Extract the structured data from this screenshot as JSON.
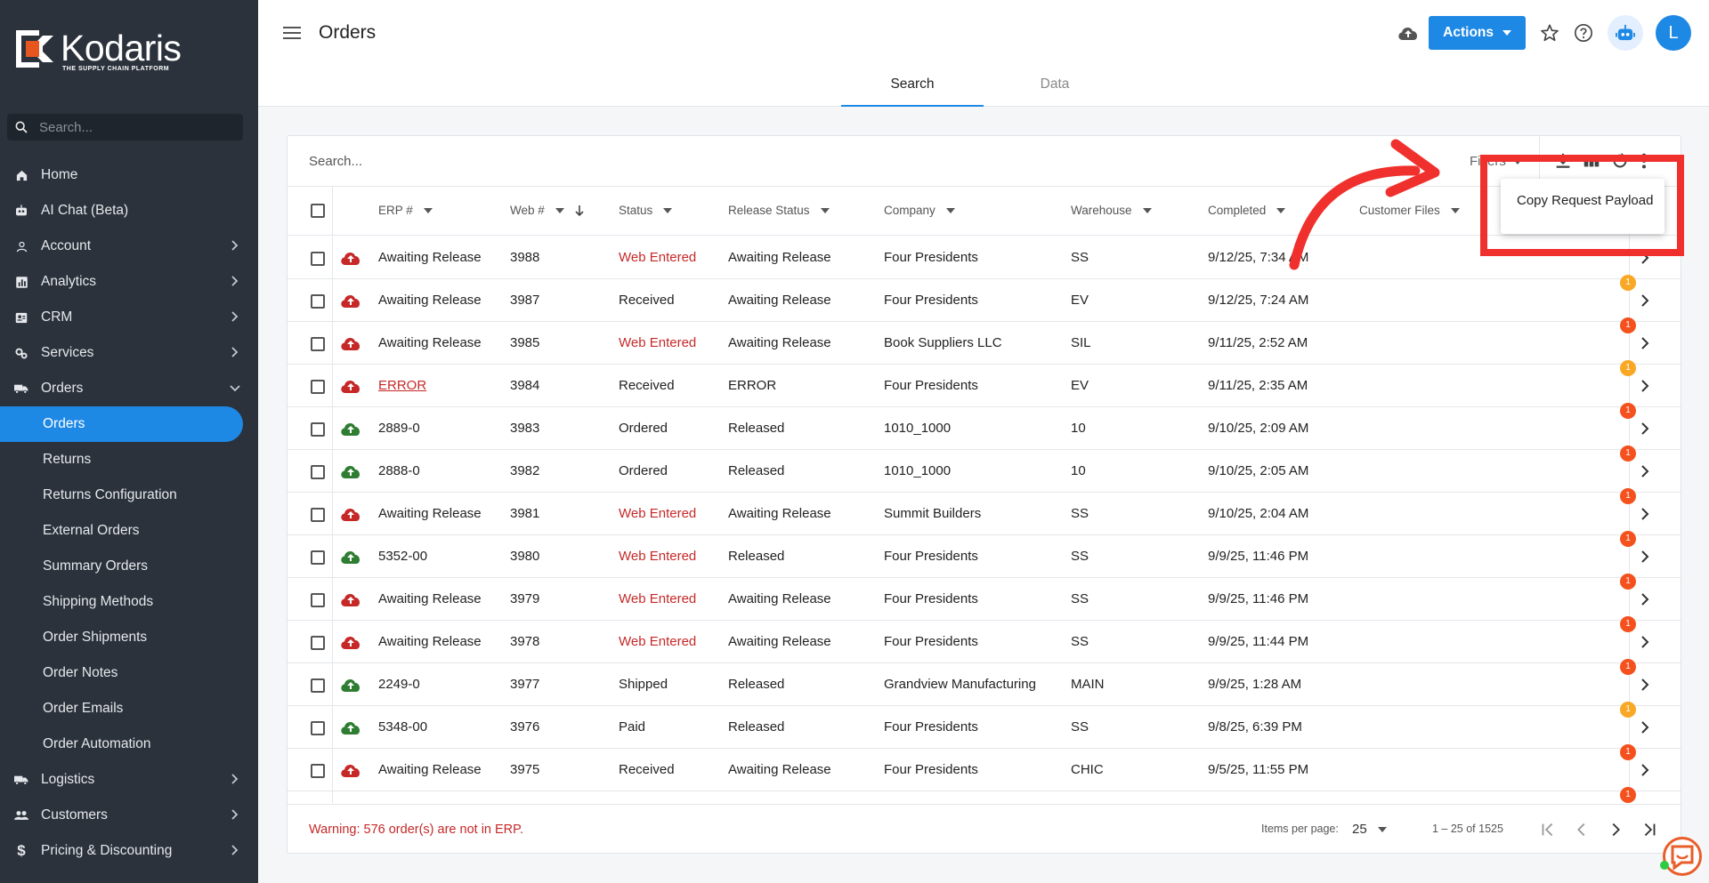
{
  "brand": {
    "name": "Kodaris",
    "tagline": "THE SUPPLY CHAIN PLATFORM",
    "accent": "#1e88e5",
    "sidebar_bg": "#2b323c"
  },
  "sidebar": {
    "search_placeholder": "Search...",
    "items": [
      {
        "label": "Home",
        "icon": "home-icon"
      },
      {
        "label": "AI Chat (Beta)",
        "icon": "robot-icon"
      },
      {
        "label": "Account",
        "icon": "person-icon",
        "chevron": "right"
      },
      {
        "label": "Analytics",
        "icon": "chart-icon",
        "chevron": "right"
      },
      {
        "label": "CRM",
        "icon": "contact-card-icon",
        "chevron": "right"
      },
      {
        "label": "Services",
        "icon": "services-icon",
        "chevron": "right"
      },
      {
        "label": "Orders",
        "icon": "truck-icon",
        "chevron": "down"
      }
    ],
    "order_subitems": [
      {
        "label": "Orders",
        "active": true
      },
      {
        "label": "Returns"
      },
      {
        "label": "Returns Configuration"
      },
      {
        "label": "External Orders"
      },
      {
        "label": "Summary Orders"
      },
      {
        "label": "Shipping Methods"
      },
      {
        "label": "Order Shipments"
      },
      {
        "label": "Order Notes"
      },
      {
        "label": "Order Emails"
      },
      {
        "label": "Order Automation"
      }
    ],
    "bottom_items": [
      {
        "label": "Logistics",
        "icon": "logistics-icon",
        "chevron": "right"
      },
      {
        "label": "Customers",
        "icon": "group-icon",
        "chevron": "right"
      },
      {
        "label": "Pricing & Discounting",
        "icon": "dollar-icon",
        "chevron": "right"
      }
    ]
  },
  "header": {
    "title": "Orders",
    "actions_label": "Actions",
    "avatar_letter": "L",
    "tabs": [
      {
        "label": "Search",
        "active": true
      },
      {
        "label": "Data"
      }
    ]
  },
  "table": {
    "search_placeholder": "Search...",
    "filters_label": "Filters",
    "columns": [
      "ERP #",
      "Web #",
      "Status",
      "Release Status",
      "Company",
      "Warehouse",
      "Completed",
      "Customer Files"
    ],
    "rows": [
      {
        "erp": "Awaiting Release",
        "web": "3988",
        "status": "Web Entered",
        "release": "Awaiting Release",
        "company": "Four Presidents",
        "warehouse": "SS",
        "completed": "9/12/25, 7:34 AM",
        "upload": "red",
        "status_red": true,
        "badge": ""
      },
      {
        "erp": "Awaiting Release",
        "web": "3987",
        "status": "Received",
        "release": "Awaiting Release",
        "company": "Four Presidents",
        "warehouse": "EV",
        "completed": "9/12/25, 7:24 AM",
        "upload": "red",
        "badge": "1",
        "badge_color": "amber"
      },
      {
        "erp": "Awaiting Release",
        "web": "3985",
        "status": "Web Entered",
        "release": "Awaiting Release",
        "company": "Book Suppliers LLC",
        "warehouse": "SIL",
        "completed": "9/11/25, 2:52 AM",
        "upload": "red",
        "status_red": true,
        "badge": "1",
        "badge_color": "red"
      },
      {
        "erp": "ERROR",
        "web": "3984",
        "status": "Received",
        "release": "ERROR",
        "company": "Four Presidents",
        "warehouse": "EV",
        "completed": "9/11/25, 2:35 AM",
        "upload": "red",
        "erp_link": true,
        "badge": "1",
        "badge_color": "amber"
      },
      {
        "erp": "2889-0",
        "web": "3983",
        "status": "Ordered",
        "release": "Released",
        "company": "1010_1000",
        "warehouse": "10",
        "completed": "9/10/25, 2:09 AM",
        "upload": "green",
        "badge": "1",
        "badge_color": "red"
      },
      {
        "erp": "2888-0",
        "web": "3982",
        "status": "Ordered",
        "release": "Released",
        "company": "1010_1000",
        "warehouse": "10",
        "completed": "9/10/25, 2:05 AM",
        "upload": "green",
        "badge": "1",
        "badge_color": "red"
      },
      {
        "erp": "Awaiting Release",
        "web": "3981",
        "status": "Web Entered",
        "release": "Awaiting Release",
        "company": "Summit Builders",
        "warehouse": "SS",
        "completed": "9/10/25, 2:04 AM",
        "upload": "red",
        "status_red": true,
        "badge": "1",
        "badge_color": "red"
      },
      {
        "erp": "5352-00",
        "web": "3980",
        "status": "Web Entered",
        "release": "Released",
        "company": "Four Presidents",
        "warehouse": "SS",
        "completed": "9/9/25, 11:46 PM",
        "upload": "green",
        "status_red": true,
        "badge": "1",
        "badge_color": "red"
      },
      {
        "erp": "Awaiting Release",
        "web": "3979",
        "status": "Web Entered",
        "release": "Awaiting Release",
        "company": "Four Presidents",
        "warehouse": "SS",
        "completed": "9/9/25, 11:46 PM",
        "upload": "red",
        "status_red": true,
        "badge": "1",
        "badge_color": "red"
      },
      {
        "erp": "Awaiting Release",
        "web": "3978",
        "status": "Web Entered",
        "release": "Awaiting Release",
        "company": "Four Presidents",
        "warehouse": "SS",
        "completed": "9/9/25, 11:44 PM",
        "upload": "red",
        "status_red": true,
        "badge": "1",
        "badge_color": "red"
      },
      {
        "erp": "2249-0",
        "web": "3977",
        "status": "Shipped",
        "release": "Released",
        "company": "Grandview Manufacturing",
        "warehouse": "MAIN",
        "completed": "9/9/25, 1:28 AM",
        "upload": "green",
        "badge": "1",
        "badge_color": "red"
      },
      {
        "erp": "5348-00",
        "web": "3976",
        "status": "Paid",
        "release": "Released",
        "company": "Four Presidents",
        "warehouse": "SS",
        "completed": "9/8/25, 6:39 PM",
        "upload": "green",
        "badge": "1",
        "badge_color": "amber"
      },
      {
        "erp": "Awaiting Release",
        "web": "3975",
        "status": "Received",
        "release": "Awaiting Release",
        "company": "Four Presidents",
        "warehouse": "CHIC",
        "completed": "9/5/25, 11:55 PM",
        "upload": "red",
        "badge": "1",
        "badge_color": "red"
      }
    ],
    "trailing_badge": "1"
  },
  "footer": {
    "warning": "Warning: 576 order(s) are not in ERP.",
    "items_per_page_label": "Items per page:",
    "items_per_page": "25",
    "range": "1 – 25 of 1525"
  },
  "menu": {
    "copy_payload": "Copy Request Payload"
  },
  "colors": {
    "status_red": "#c62828",
    "badge_red": "#f4511e",
    "badge_amber": "#f9a825",
    "upload_green": "#2e7d32",
    "upload_red": "#c62828",
    "annotation_red": "#f0302d"
  }
}
